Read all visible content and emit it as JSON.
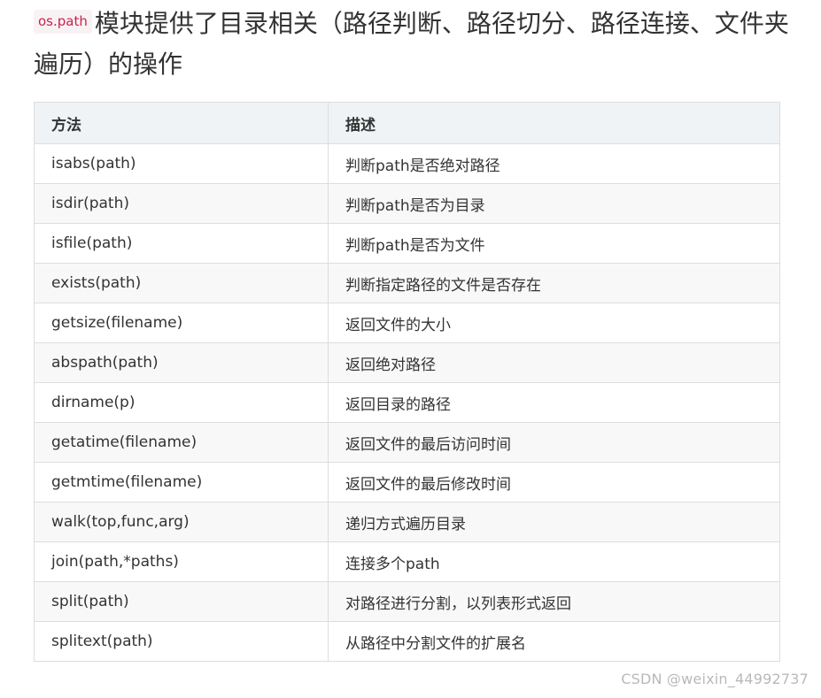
{
  "heading": {
    "code": "os.path",
    "text": "模块提供了目录相关（路径判断、路径切分、路径连接、文件夹遍历）的操作"
  },
  "table": {
    "headers": [
      "方法",
      "描述"
    ],
    "rows": [
      [
        "isabs(path)",
        "判断path是否绝对路径"
      ],
      [
        "isdir(path)",
        "判断path是否为目录"
      ],
      [
        "isfile(path)",
        "判断path是否为文件"
      ],
      [
        "exists(path)",
        "判断指定路径的文件是否存在"
      ],
      [
        "getsize(filename)",
        "返回文件的大小"
      ],
      [
        "abspath(path)",
        "返回绝对路径"
      ],
      [
        "dirname(p)",
        "返回目录的路径"
      ],
      [
        "getatime(filename)",
        "返回文件的最后访问时间"
      ],
      [
        "getmtime(filename)",
        "返回文件的最后修改时间"
      ],
      [
        "walk(top,func,arg)",
        "递归方式遍历目录"
      ],
      [
        "join(path,*paths)",
        "连接多个path"
      ],
      [
        "split(path)",
        "对路径进行分割，以列表形式返回"
      ],
      [
        "splitext(path)",
        "从路径中分割文件的扩展名"
      ]
    ]
  },
  "watermark": "CSDN @weixin_44992737"
}
